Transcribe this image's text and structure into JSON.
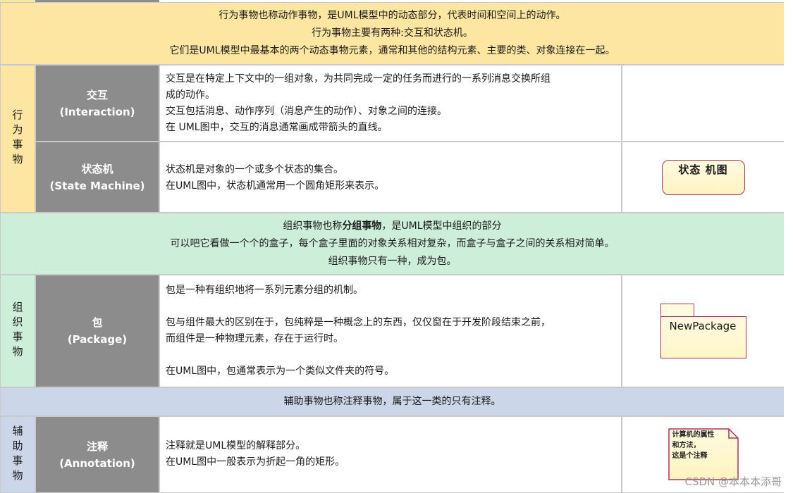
{
  "bands": {
    "behavior": [
      "行为事物也称动作事物，是UML模型中的动态部分，代表时间和空间上的动作。",
      "行为事物主要有两种:交互和状态机。",
      "它们是UML模型中最基本的两个动态事物元素，通常和其他的结构元素、主要的类、对象连接在一起。"
    ],
    "grouping_pre": "组织事物也称",
    "grouping_bold": "分组事物",
    "grouping_post": "，是UML模型中组织的部分",
    "grouping": [
      "可以吧它看做一个个的盒子，每个盒子里面的对象关系相对复杂，而盒子与盒子之间的关系相对简单。",
      "组织事物只有一种，成为包。"
    ],
    "annotation": "辅助事物也称注释事物，属于这一类的只有注释。"
  },
  "categories": {
    "behavior": "行为事物",
    "grouping": "组织事物",
    "annotation": "辅助事物"
  },
  "rows": {
    "interaction": {
      "name": "交互",
      "name_en": "(Interaction)",
      "lines": [
        "交互是在特定上下文中的一组对象，为共同完成一定的任务而进行的一系列消息交换所组",
        "成的动作。",
        "交互包括消息、动作序列（消息产生的动作）、对象之间的连接。",
        "在 UML图中，交互的消息通常画成带箭头的直线。"
      ]
    },
    "state_machine": {
      "name": "状态机",
      "name_en": "(State Machine)",
      "lines": [
        "状态机是对象的一个或多个状态的集合。",
        "在UML图中，状态机通常用一个圆角矩形来表示。"
      ],
      "figure_label": "状态 机图"
    },
    "package": {
      "name": "包",
      "name_en": "(Package)",
      "lines": [
        "包是一种有组织地将一系列元素分组的机制。",
        "",
        "包与组件最大的区别在于，包纯粹是一种概念上的东西，仅仅窗在于开发阶段结束之前，",
        "而组件是一种物理元素，存在于运行时。",
        "",
        "在UML图中，包通常表示为一个类似文件夹的符号。"
      ],
      "figure_label": "NewPackage"
    },
    "annotation": {
      "name": "注释",
      "name_en": "(Annotation)",
      "lines": [
        "注释就是UML模型的解释部分。",
        "在UML图中一般表示为折起一角的矩形。"
      ],
      "figure_lines": [
        "计算机的属性",
        "和方法，",
        "这是个注释"
      ]
    }
  },
  "watermark": "CSDN @本本本添哥",
  "colors": {
    "behavior_bg": "#fde6a1",
    "grouping_bg": "#cdeed8",
    "annotation_bg": "#cbd6e9",
    "name_bg": "#8c8c8c",
    "figure_border": "#b0305a"
  }
}
